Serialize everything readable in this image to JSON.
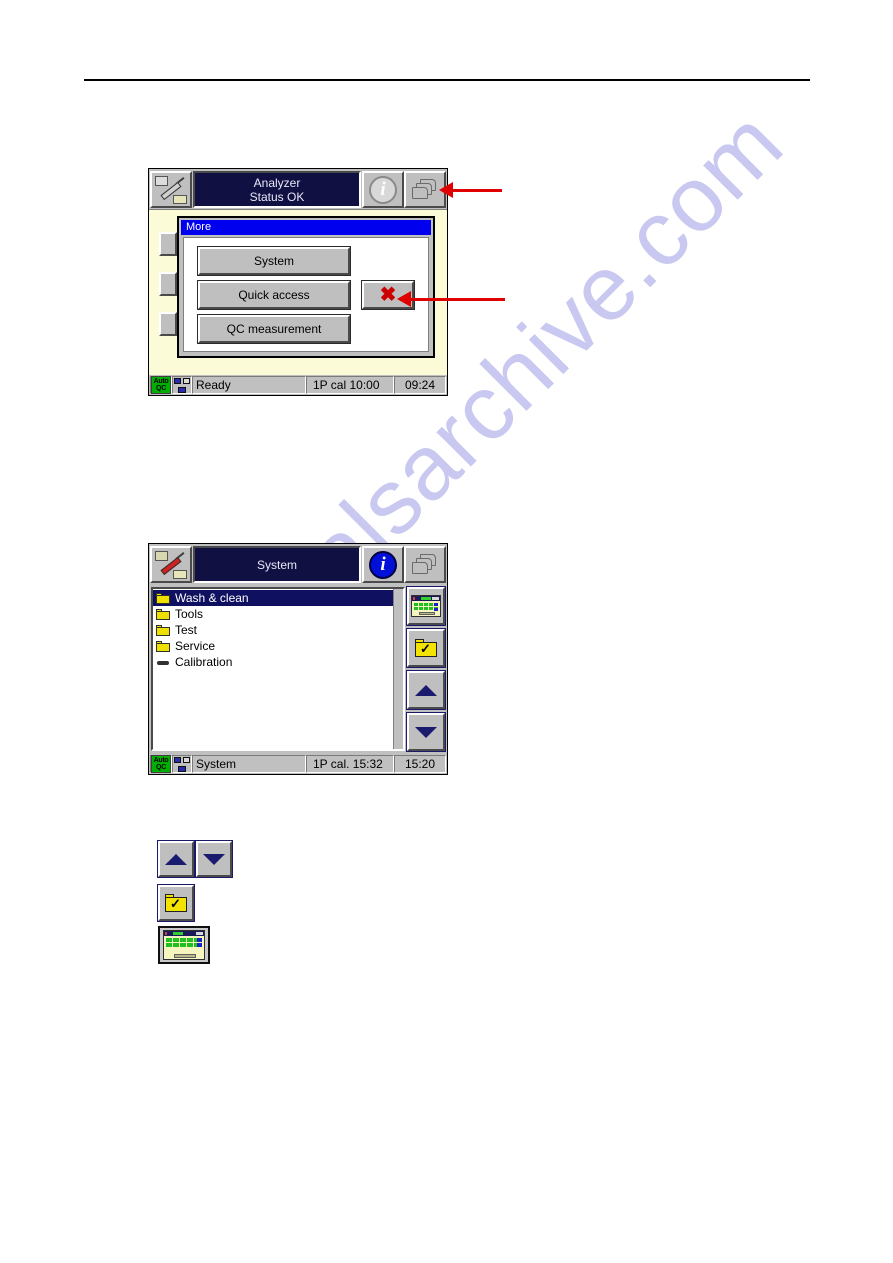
{
  "page": {
    "watermark": "manualsarchive.com"
  },
  "screen_more": {
    "title_line1": "Analyzer",
    "title_line2": "Status OK",
    "icons": {
      "left": "syringe-sampler-icon",
      "info": "info-icon",
      "print": "print-stack-icon"
    },
    "dialog": {
      "title": "More",
      "buttons": [
        {
          "label": "System",
          "name": "system-button"
        },
        {
          "label": "Quick access",
          "name": "quick-access-button"
        },
        {
          "label": "QC measurement",
          "name": "qc-measurement-button"
        }
      ],
      "close_glyph": "✖"
    },
    "statusbar": {
      "qc_line1": "Auto",
      "qc_line2": "QC",
      "state": "Ready",
      "calibration": "1P cal 10:00",
      "time": "09:24"
    }
  },
  "screen_system": {
    "title_line1": "System",
    "title_line2": "",
    "icons": {
      "left": "syringe-sampler-icon",
      "info": "info-icon",
      "print": "print-stack-icon"
    },
    "list": [
      {
        "label": "Wash & clean",
        "icon": "folder-icon",
        "selected": true
      },
      {
        "label": "Tools",
        "icon": "folder-icon",
        "selected": false
      },
      {
        "label": "Test",
        "icon": "folder-icon",
        "selected": false
      },
      {
        "label": "Service",
        "icon": "folder-icon",
        "selected": false
      },
      {
        "label": "Calibration",
        "icon": "dash-icon",
        "selected": false
      }
    ],
    "rail": [
      {
        "name": "keypad-button",
        "icon": "keypad-icon"
      },
      {
        "name": "select-open-button",
        "icon": "folder-check-icon"
      },
      {
        "name": "scroll-up-button",
        "icon": "triangle-up-icon"
      },
      {
        "name": "scroll-down-button",
        "icon": "triangle-down-icon"
      }
    ],
    "statusbar": {
      "qc_line1": "Auto",
      "qc_line2": "QC",
      "state": "System",
      "calibration": "1P cal. 15:32",
      "time": "15:20"
    }
  },
  "legend": [
    {
      "name": "scroll-up-button",
      "icon": "triangle-up-icon"
    },
    {
      "name": "scroll-down-button",
      "icon": "triangle-down-icon"
    },
    {
      "name": "select-open-button",
      "icon": "folder-check-icon"
    },
    {
      "name": "keypad-button",
      "icon": "keypad-icon"
    }
  ],
  "colors": {
    "accent_blue": "#0000ee",
    "title_navy": "#101042",
    "panel_gray": "#c0c0c0",
    "callout_red": "#e00000",
    "folder_yellow": "#f0e000",
    "qc_green": "#00b000"
  }
}
